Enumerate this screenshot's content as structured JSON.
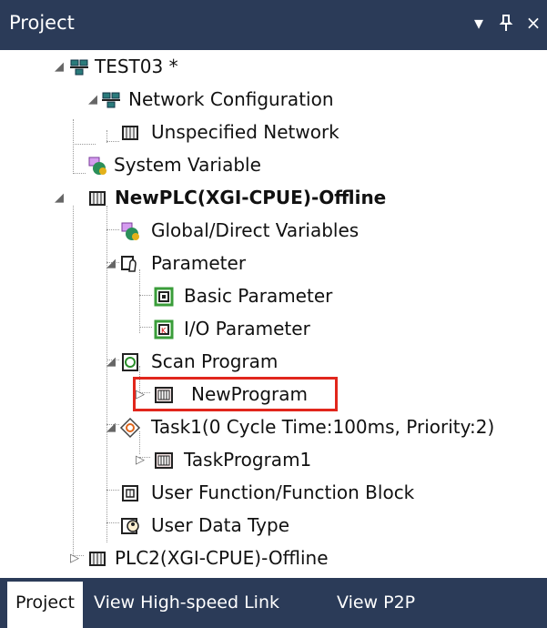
{
  "panel": {
    "title": "Project",
    "controls": {
      "menu_label": "▾",
      "pin_label": "ᵖ",
      "close_label": "×"
    }
  },
  "tree": {
    "root": "TEST03 *",
    "items": [
      "Network Configuration",
      "Unspecified Network",
      "System Variable",
      "NewPLC(XGI-CPUE)-Offline",
      "Global/Direct Variables",
      "Parameter",
      "Basic Parameter",
      "I/O Parameter",
      "Scan Program",
      "NewProgram",
      "Task1(0 Cycle Time:100ms, Priority:2)",
      "TaskProgram1",
      "User Function/Function Block",
      "User Data Type",
      "PLC2(XGI-CPUE)-Offline"
    ]
  },
  "tabs": [
    "Project",
    "View High-speed Link",
    "View P2P"
  ],
  "colors": {
    "header": "#2b3b58",
    "highlight": "#e1261c",
    "tab_active": "#ffffff"
  }
}
